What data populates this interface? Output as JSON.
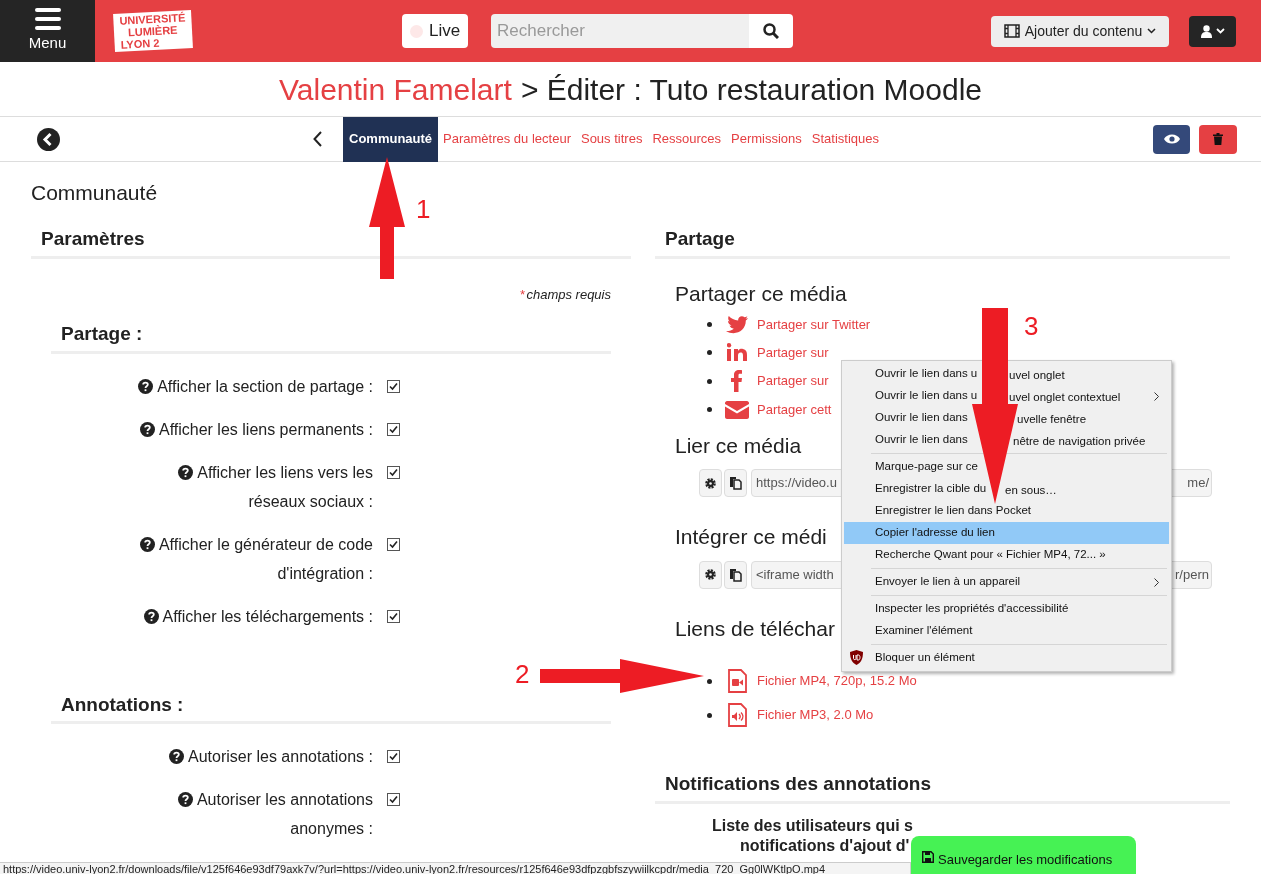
{
  "header": {
    "menu_label": "Menu",
    "logo_lines": [
      "UNIVERSITÉ",
      "LUMIÈRE",
      "LYON 2"
    ],
    "live_label": "Live",
    "search": {
      "placeholder": "Rechercher"
    },
    "add_content_label": "Ajouter du contenu"
  },
  "title": {
    "owner": "Valentin Famelart",
    "rest": "> Éditer : Tuto restauration Moodle"
  },
  "tabs": [
    {
      "label": "Communauté",
      "selected": true
    },
    {
      "label": "Paramètres du lecteur",
      "selected": false
    },
    {
      "label": "Sous titres",
      "selected": false
    },
    {
      "label": "Ressources",
      "selected": false
    },
    {
      "label": "Permissions",
      "selected": false
    },
    {
      "label": "Statistiques",
      "selected": false
    }
  ],
  "page_heading": "Communauté",
  "settings": {
    "heading": "Paramètres",
    "required_mark": "*",
    "required_note": "champs requis",
    "sections": [
      {
        "title": "Partage :",
        "options": [
          {
            "label": "Afficher la section de partage :",
            "checked": true
          },
          {
            "label": "Afficher les liens permanents :",
            "checked": true
          },
          {
            "label": "Afficher les liens vers les réseaux sociaux :",
            "checked": true
          },
          {
            "label": "Afficher le générateur de code d'intégration :",
            "checked": true
          },
          {
            "label": "Afficher les téléchargements :",
            "checked": true
          }
        ]
      },
      {
        "title": "Annotations :",
        "options": [
          {
            "label": "Autoriser les annotations :",
            "checked": true
          },
          {
            "label": "Autoriser les annotations anonymes :",
            "checked": true
          }
        ]
      }
    ]
  },
  "sharing": {
    "heading": "Partage",
    "share_heading": "Partager ce média",
    "share_links": [
      {
        "kind": "twitter",
        "label": "Partager sur Twitter"
      },
      {
        "kind": "linkedin",
        "label": "Partager sur"
      },
      {
        "kind": "facebook",
        "label": "Partager sur"
      },
      {
        "kind": "email",
        "label": "Partager cett"
      }
    ],
    "link_heading": "Lier ce média",
    "link_field": {
      "start": "https://video.u",
      "end": "me/"
    },
    "embed_heading": "Intégrer ce médi",
    "embed_field": {
      "start": "<iframe width",
      "end": "r/pern"
    },
    "downloads_heading": "Liens de téléchar",
    "downloads": [
      {
        "kind": "video",
        "label": "Fichier MP4, 720p, 15.2 Mo"
      },
      {
        "kind": "audio",
        "label": "Fichier MP3, 2.0 Mo"
      }
    ],
    "notifications_heading": "Notifications des annotations",
    "notifications_text": [
      "Liste des utilisateurs qui s",
      "notifications d'ajout d'"
    ]
  },
  "context_menu": [
    {
      "kind": "item",
      "label": "Ouvrir le lien dans u",
      "label_after": "uvel onglet"
    },
    {
      "kind": "submenu",
      "label": "Ouvrir le lien dans u",
      "label_after": "uvel onglet contextuel"
    },
    {
      "kind": "item",
      "label": "Ouvrir le lien dans",
      "label_after": "uvelle fenêtre"
    },
    {
      "kind": "item",
      "label": "Ouvrir le lien dans",
      "label_after": "nêtre de navigation privée"
    },
    {
      "kind": "separator"
    },
    {
      "kind": "item",
      "label": "Marque-page sur ce"
    },
    {
      "kind": "item",
      "label": "Enregistrer la cible du",
      "label_after": "en sous…"
    },
    {
      "kind": "item",
      "label": "Enregistrer le lien dans Pocket"
    },
    {
      "kind": "item",
      "label": "Copier l'adresse du lien",
      "selected": true
    },
    {
      "kind": "item",
      "label": "Recherche Qwant pour « Fichier MP4, 72... »"
    },
    {
      "kind": "separator"
    },
    {
      "kind": "submenu",
      "label": "Envoyer le lien à un appareil"
    },
    {
      "kind": "separator"
    },
    {
      "kind": "item",
      "label": "Inspecter les propriétés d'accessibilité"
    },
    {
      "kind": "item",
      "label": "Examiner l'élément"
    },
    {
      "kind": "separator"
    },
    {
      "kind": "extension",
      "label": "Bloquer un élément"
    }
  ],
  "annotations": [
    {
      "label": "1"
    },
    {
      "label": "2"
    },
    {
      "label": "3"
    }
  ],
  "save_button": "Sauvegarder les modifications",
  "status_bar": "https://video.univ-lyon2.fr/downloads/file/v125f646e93df79axk7v/?url=https://video.univ-lyon2.fr/resources/r125f646e93dfpzgbfszywiilkcpdr/media_720_Gg0lWKtlpO.mp4"
}
